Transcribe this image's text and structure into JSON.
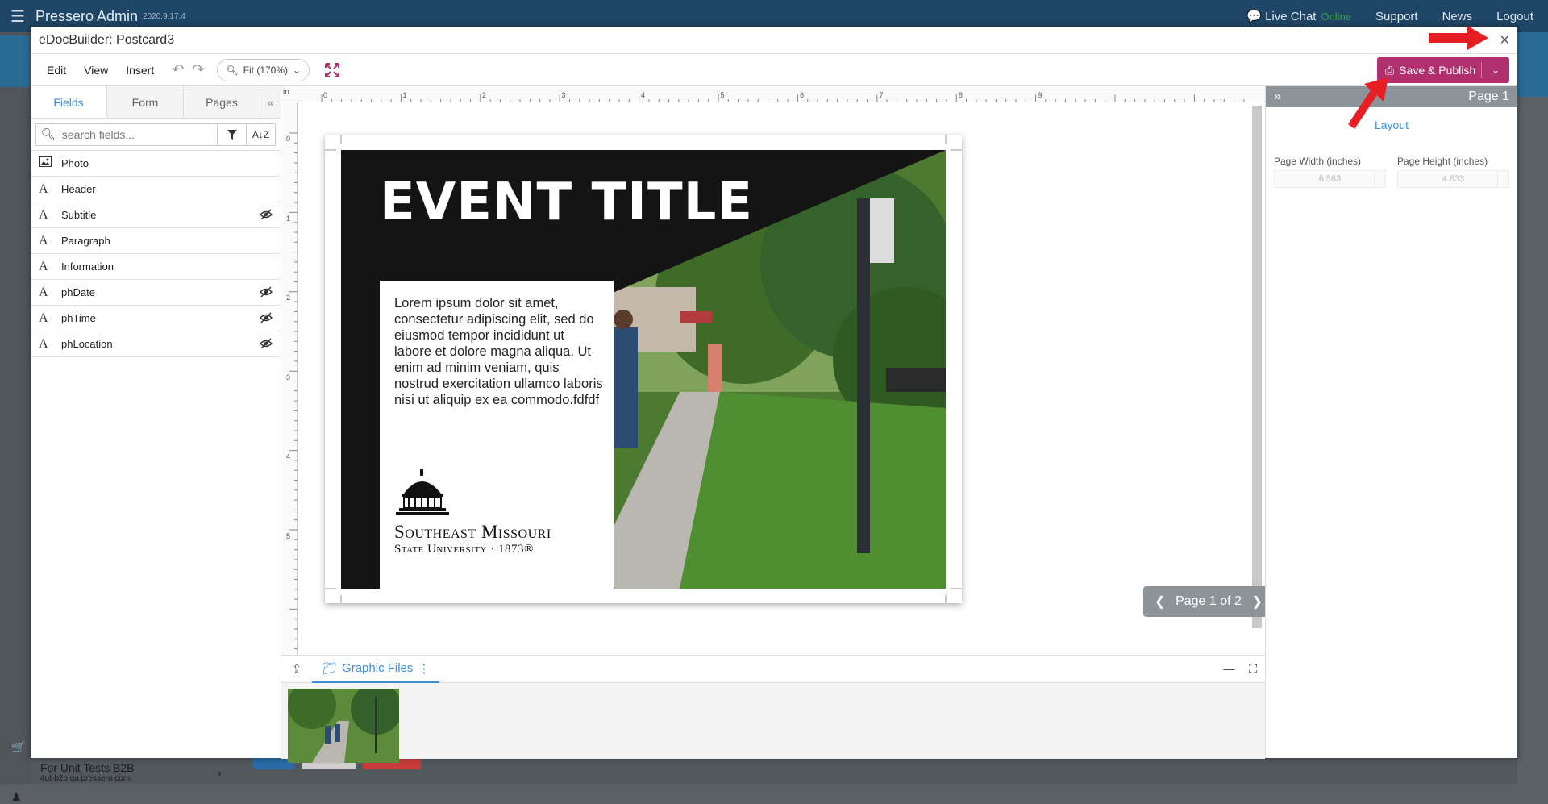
{
  "topbar": {
    "brand": "Pressero Admin",
    "version": "2020.9.17.4",
    "live_chat": "Live Chat",
    "online": "Online",
    "support": "Support",
    "news": "News",
    "logout": "Logout"
  },
  "behind": {
    "account_name": "For Unit Tests B2B",
    "account_url": "4ut-b2b.qa.pressero.com"
  },
  "dialog": {
    "title": "eDocBuilder: Postcard3",
    "close": "×"
  },
  "toolbar": {
    "edit": "Edit",
    "view": "View",
    "insert": "Insert",
    "zoom": "Fit (170%)",
    "save_publish": "Save & Publish"
  },
  "left_panel": {
    "tabs": [
      "Fields",
      "Form",
      "Pages"
    ],
    "search_placeholder": "search fields...",
    "fields": [
      {
        "label": "Photo",
        "icon": "image-icon",
        "hidden": false
      },
      {
        "label": "Header",
        "icon": "text-icon",
        "hidden": false
      },
      {
        "label": "Subtitle",
        "icon": "text-icon",
        "hidden": true
      },
      {
        "label": "Paragraph",
        "icon": "text-icon",
        "hidden": false
      },
      {
        "label": "Information",
        "icon": "text-icon",
        "hidden": false
      },
      {
        "label": "phDate",
        "icon": "text-icon",
        "hidden": true
      },
      {
        "label": "phTime",
        "icon": "text-icon",
        "hidden": true
      },
      {
        "label": "phLocation",
        "icon": "text-icon",
        "hidden": true
      }
    ]
  },
  "canvas": {
    "ruler_unit": "in",
    "ruler_top": [
      "0",
      "1",
      "2",
      "3",
      "4",
      "5",
      "6",
      "7",
      "8",
      "9"
    ],
    "ruler_left": [
      "0",
      "1",
      "2",
      "3",
      "4",
      "5"
    ],
    "event_title": "EVENT TITLE",
    "paragraph": "Lorem ipsum dolor sit amet, consectetur adipiscing elit, sed do eiusmod tempor incididunt ut labore et dolore magna aliqua. Ut enim ad minim veniam, quis nostrud exercitation ullamco laboris nisi ut aliquip ex ea commodo.fdfdf",
    "logo_line1": "Southeast Missouri",
    "logo_line2": "State University · 1873®",
    "pager": "Page 1 of 2"
  },
  "bottom_panel": {
    "tab": "Graphic Files"
  },
  "right_panel": {
    "title": "Page 1",
    "layout": "Layout",
    "page_width_label": "Page Width (inches)",
    "page_width": "6.583",
    "page_height_label": "Page Height (inches)",
    "page_height": "4.833"
  },
  "colors": {
    "topbar": "#1f4666",
    "accent": "#3a8fd8",
    "save_button": "#b0306e",
    "annotation_arrow": "#e81e25"
  }
}
